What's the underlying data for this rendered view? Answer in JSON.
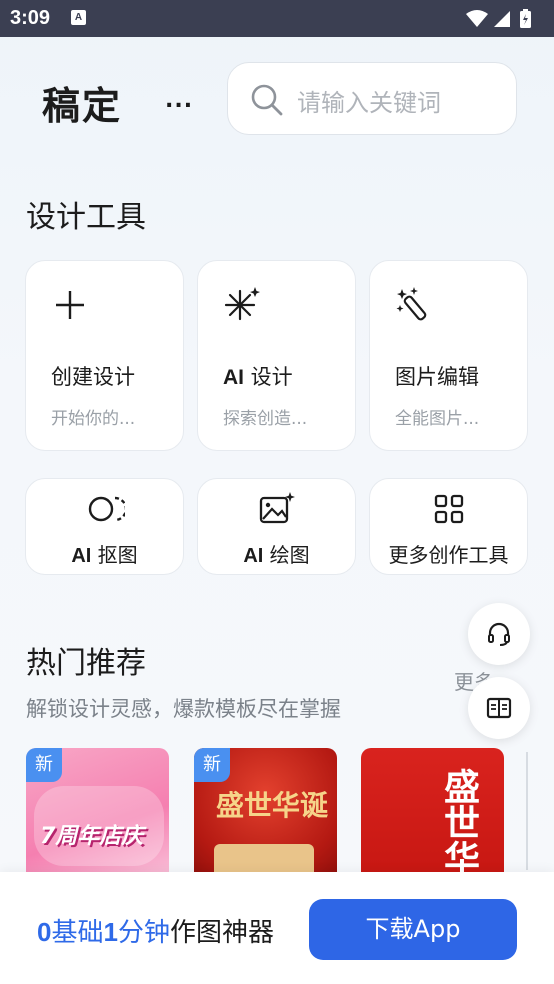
{
  "status_bar": {
    "time": "3:09",
    "notification_icon": "A"
  },
  "header": {
    "logo": "稿定",
    "more": "...",
    "search_placeholder": "请输入关键词"
  },
  "design_tools": {
    "title": "设计工具",
    "cards": [
      {
        "icon": "plus-icon",
        "title": "创建设计",
        "subtitle": "开始你的..."
      },
      {
        "icon": "sparkle-icon",
        "title_prefix": "AI",
        "title": " 设计",
        "subtitle": "探索创造..."
      },
      {
        "icon": "magic-wand-icon",
        "title": "图片编辑",
        "subtitle": "全能图片..."
      }
    ],
    "small_cards": [
      {
        "icon": "cutout-icon",
        "label_prefix": "AI",
        "label": " 抠图"
      },
      {
        "icon": "image-sparkle-icon",
        "label_prefix": "AI",
        "label": " 绘图"
      },
      {
        "icon": "grid-icon",
        "label": "更多创作工具"
      }
    ]
  },
  "hot": {
    "title": "热门推荐",
    "subtitle": "解锁设计灵感，爆款模板尽在掌握",
    "more": "更多 ›",
    "badge": "新",
    "thumbs": [
      {
        "text": "7周年店庆"
      },
      {
        "text": "盛世华诞"
      },
      {
        "text": "盛世华"
      }
    ]
  },
  "bottom": {
    "promo_part1": "0",
    "promo_part2": "基础",
    "promo_part3": "1",
    "promo_part4": "分钟",
    "promo_part5": "作图神器",
    "download": "下载App"
  },
  "colors": {
    "accent": "#2e66e6",
    "status_bar": "#3b3f52"
  }
}
